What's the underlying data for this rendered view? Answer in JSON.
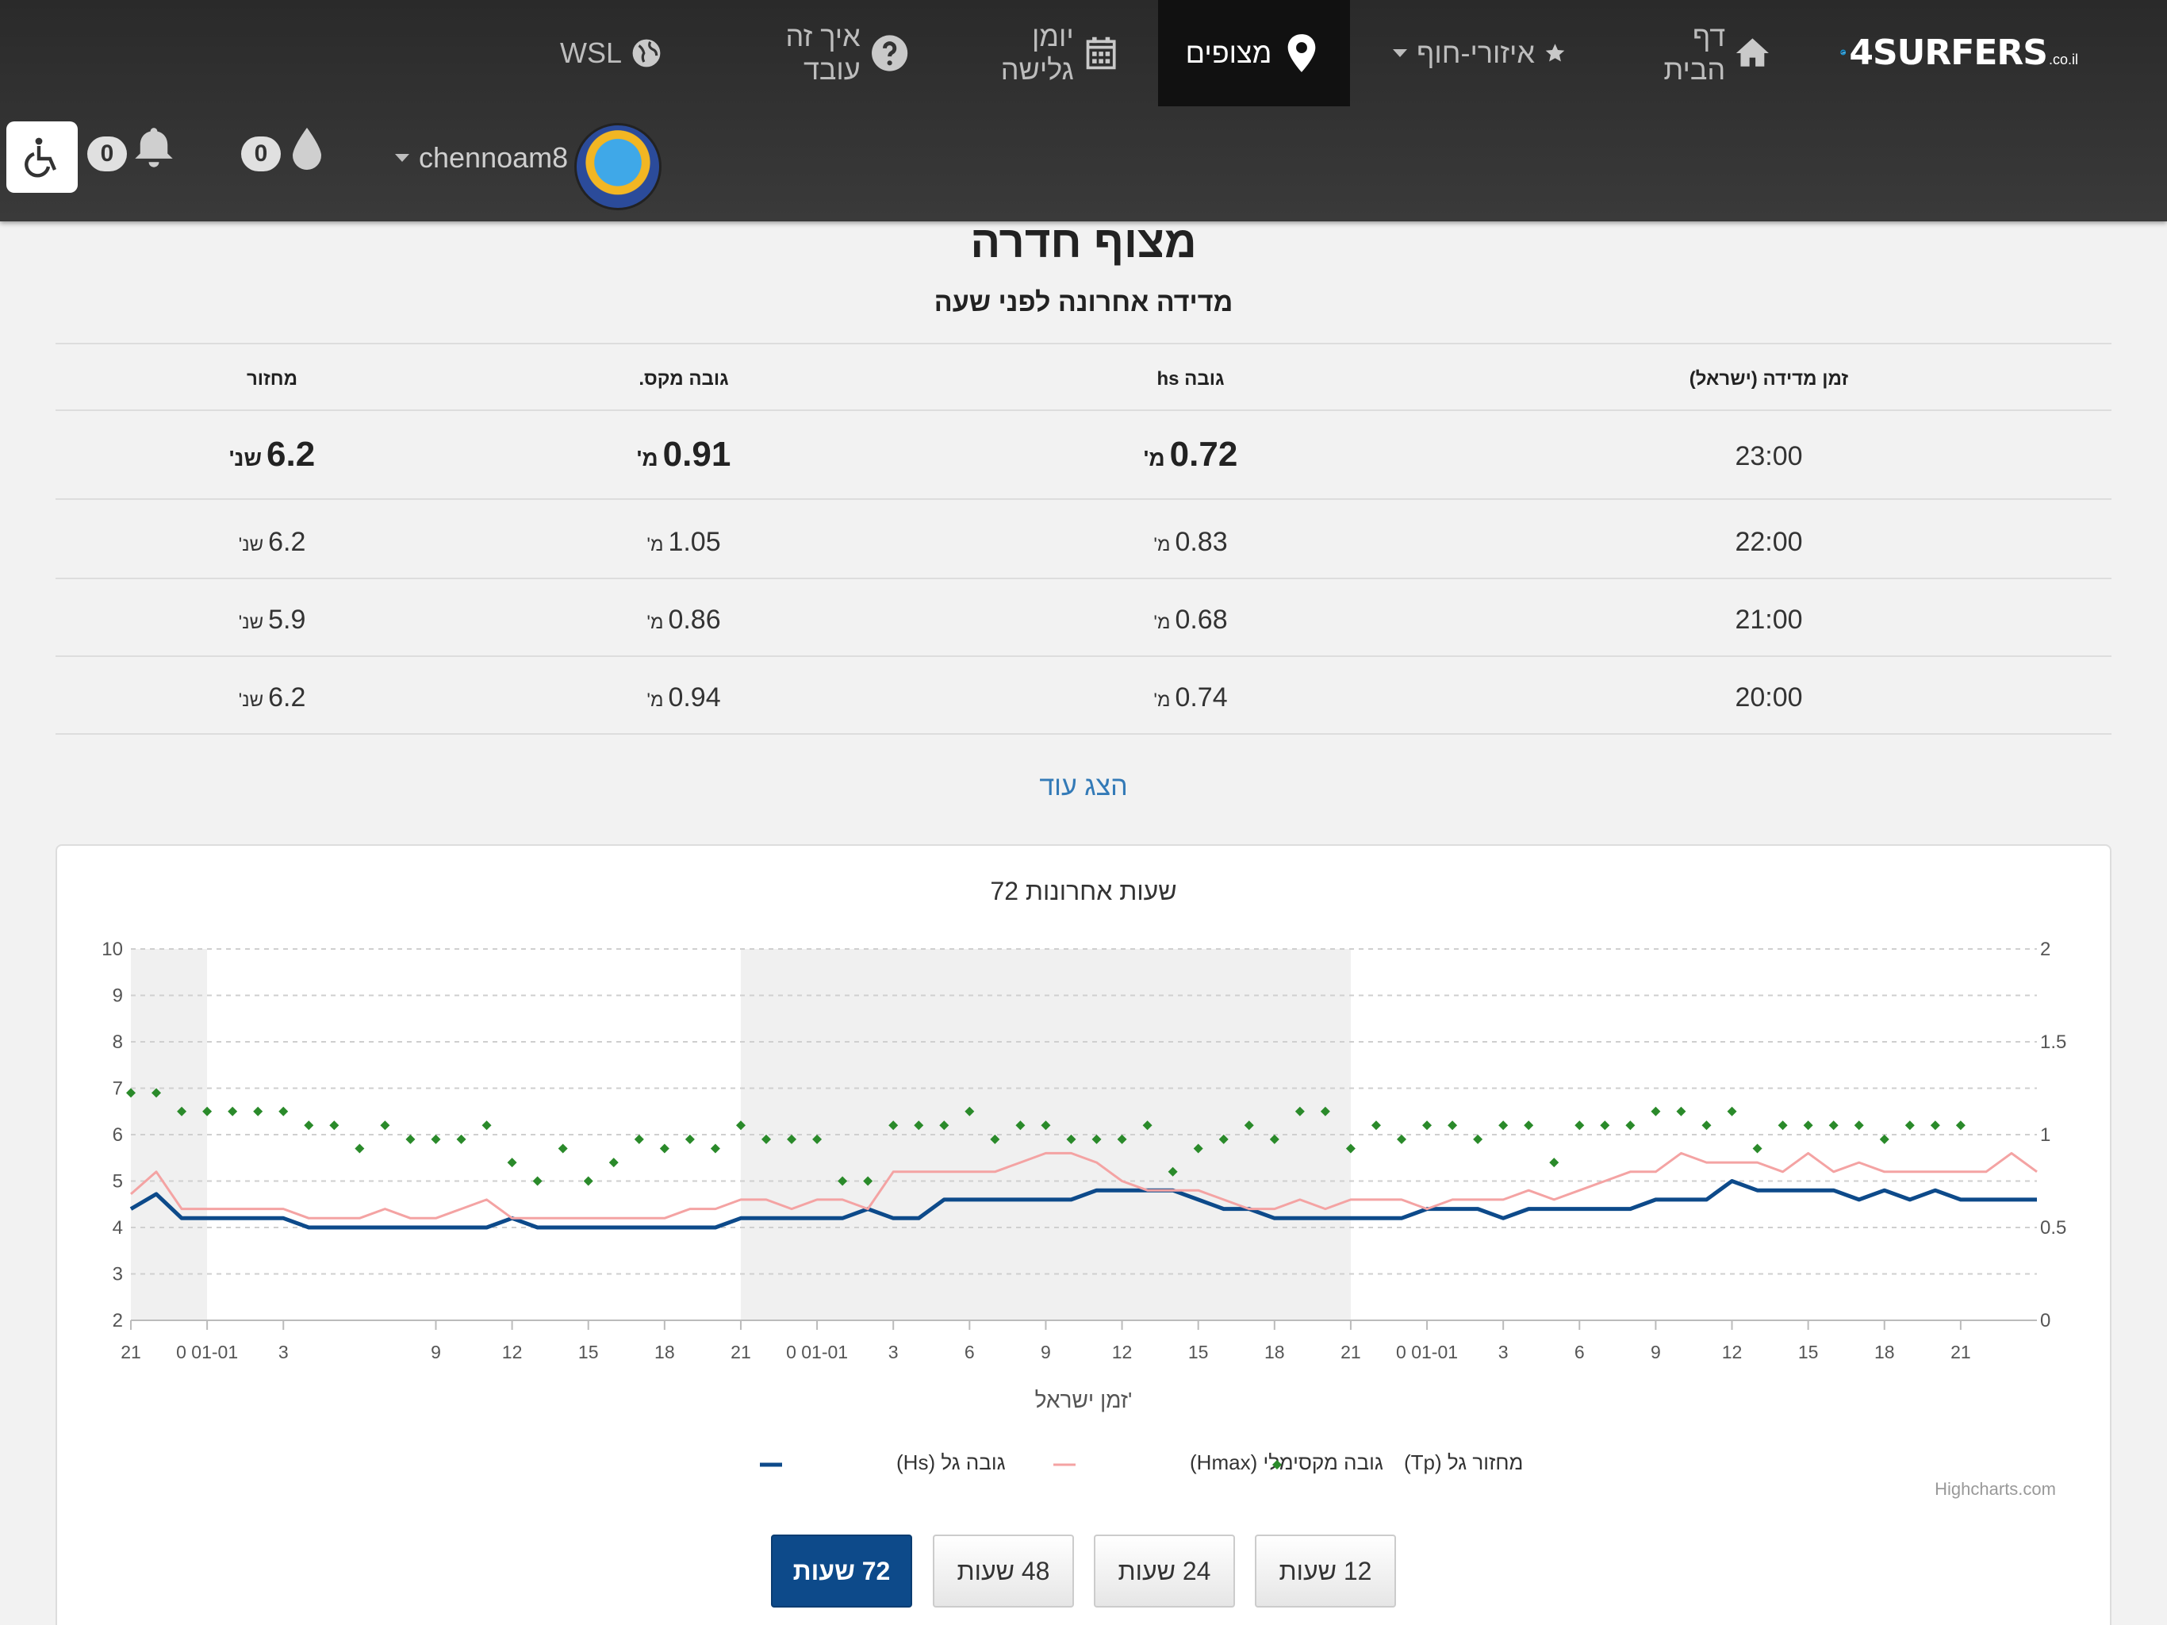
{
  "nav": {
    "logo_text": "4SURFERS",
    "logo_tld": ".co.il",
    "items": [
      {
        "label": "דף הבית",
        "icon": "home-icon"
      },
      {
        "label": "איזורי-חוף",
        "icon": "star-icon"
      },
      {
        "label": "מצופים",
        "icon": "map-marker-icon",
        "active": true
      },
      {
        "label": "יומן גלישה",
        "icon": "calendar-icon"
      },
      {
        "label": "איך זה עובד",
        "icon": "question-icon"
      },
      {
        "label": "WSL",
        "icon": "globe-icon"
      }
    ],
    "username": "chennoam8",
    "drops_count": "0",
    "notifications_count": "0"
  },
  "page": {
    "title": "מצוף חדרה",
    "subtitle": "מדידה אחרונה לפני שעה",
    "more_link": "הצג עוד"
  },
  "table": {
    "headers": [
      "זמן מדידה (ישראל)",
      "גובה hs",
      "גובה מקס.",
      "מחזור"
    ],
    "height_unit": "מ'",
    "period_unit": "שנ'",
    "rows": [
      {
        "time": "23:00",
        "hs": "0.72",
        "hmax": "0.91",
        "period": "6.2"
      },
      {
        "time": "22:00",
        "hs": "0.83",
        "hmax": "1.05",
        "period": "6.2"
      },
      {
        "time": "21:00",
        "hs": "0.68",
        "hmax": "0.86",
        "period": "5.9"
      },
      {
        "time": "20:00",
        "hs": "0.74",
        "hmax": "0.94",
        "period": "6.2"
      }
    ]
  },
  "chart_data": {
    "type": "line",
    "title": "72 שעות אחרונות",
    "xlabel": "זמן ישראל'",
    "credit": "Highcharts.com",
    "left_axis": {
      "min": 2,
      "max": 10,
      "ticks": [
        "2",
        "3",
        "4",
        "5",
        "6",
        "7",
        "8",
        "9",
        "10"
      ]
    },
    "right_axis": {
      "min": 0,
      "max": 2,
      "ticks": [
        "0",
        "0.5",
        "1",
        "1.5",
        "2"
      ]
    },
    "x_tick_labels": [
      "21",
      "0 01-01",
      "3",
      "9",
      "12",
      "15",
      "18",
      "21",
      "0 01-01",
      "3",
      "6",
      "9",
      "12",
      "15",
      "18",
      "21",
      "0 01-01",
      "3",
      "6",
      "9",
      "12",
      "15",
      "18",
      "21"
    ],
    "x_tick_hours": [
      0,
      3,
      6,
      12,
      15,
      18,
      21,
      24,
      27,
      30,
      33,
      36,
      39,
      42,
      45,
      48,
      51,
      54,
      57,
      60,
      63,
      66,
      69,
      72
    ],
    "night_bands": [
      [
        0,
        3
      ],
      [
        24,
        48
      ]
    ],
    "hours": [
      0,
      1,
      2,
      3,
      4,
      5,
      6,
      7,
      8,
      9,
      10,
      11,
      12,
      13,
      14,
      15,
      16,
      17,
      18,
      19,
      20,
      21,
      22,
      23,
      24,
      25,
      26,
      27,
      28,
      29,
      30,
      31,
      32,
      33,
      34,
      35,
      36,
      37,
      38,
      39,
      40,
      41,
      42,
      43,
      44,
      45,
      46,
      47,
      48,
      49,
      50,
      51,
      52,
      53,
      54,
      55,
      56,
      57,
      58,
      59,
      60,
      61,
      62,
      63,
      64,
      65,
      66,
      67,
      68,
      69,
      70,
      71,
      72,
      73,
      74,
      75
    ],
    "series": [
      {
        "name": "גובה גל (Hs)",
        "axis": "right",
        "color": "#0d4a8a",
        "values": [
          0.6,
          0.68,
          0.55,
          0.55,
          0.55,
          0.55,
          0.55,
          0.5,
          0.5,
          0.5,
          0.5,
          0.5,
          0.5,
          0.5,
          0.5,
          0.55,
          0.5,
          0.5,
          0.5,
          0.5,
          0.5,
          0.5,
          0.5,
          0.5,
          0.55,
          0.55,
          0.55,
          0.55,
          0.55,
          0.6,
          0.55,
          0.55,
          0.65,
          0.65,
          0.65,
          0.65,
          0.65,
          0.65,
          0.7,
          0.7,
          0.7,
          0.7,
          0.65,
          0.6,
          0.6,
          0.55,
          0.55,
          0.55,
          0.55,
          0.55,
          0.55,
          0.6,
          0.6,
          0.6,
          0.55,
          0.6,
          0.6,
          0.6,
          0.6,
          0.6,
          0.65,
          0.65,
          0.65,
          0.75,
          0.7,
          0.7,
          0.7,
          0.7,
          0.65,
          0.7,
          0.65,
          0.7,
          0.65,
          0.65,
          0.65,
          0.65,
          0.7,
          0.65
        ]
      },
      {
        "name": "גובה מקסימלי (Hmax)",
        "axis": "right",
        "color": "#f4a3a3",
        "values": [
          0.68,
          0.8,
          0.6,
          0.6,
          0.6,
          0.6,
          0.6,
          0.55,
          0.55,
          0.55,
          0.6,
          0.55,
          0.55,
          0.6,
          0.65,
          0.55,
          0.55,
          0.55,
          0.55,
          0.55,
          0.55,
          0.55,
          0.6,
          0.6,
          0.65,
          0.65,
          0.6,
          0.65,
          0.65,
          0.6,
          0.8,
          0.8,
          0.8,
          0.8,
          0.8,
          0.85,
          0.9,
          0.9,
          0.85,
          0.75,
          0.7,
          0.7,
          0.7,
          0.65,
          0.6,
          0.6,
          0.65,
          0.6,
          0.65,
          0.65,
          0.65,
          0.6,
          0.65,
          0.65,
          0.65,
          0.7,
          0.65,
          0.7,
          0.75,
          0.8,
          0.8,
          0.9,
          0.85,
          0.85,
          0.85,
          0.8,
          0.9,
          0.8,
          0.85,
          0.8,
          0.8,
          0.8,
          0.8,
          0.8,
          0.9,
          0.8
        ]
      },
      {
        "name": "מחזור גל (Tp)",
        "axis": "left",
        "color": "#2a8a2a",
        "type": "scatter",
        "values": [
          6.9,
          6.9,
          6.5,
          6.5,
          6.5,
          6.5,
          6.5,
          6.2,
          6.2,
          5.7,
          6.2,
          5.9,
          5.9,
          5.9,
          6.2,
          5.4,
          5,
          5.7,
          5,
          5.4,
          5.9,
          5.7,
          5.9,
          5.7,
          6.2,
          5.9,
          5.9,
          5.9,
          5,
          5,
          6.2,
          6.2,
          6.2,
          6.5,
          5.9,
          6.2,
          6.2,
          5.9,
          5.9,
          5.9,
          6.2,
          5.2,
          5.7,
          5.9,
          6.2,
          5.9,
          6.5,
          6.5,
          5.7,
          6.2,
          5.9,
          6.2,
          6.2,
          5.9,
          6.2,
          6.2,
          5.4,
          6.2,
          6.2,
          6.2,
          6.5,
          6.5,
          6.2,
          6.5,
          5.7,
          6.2,
          6.2,
          6.2,
          6.2,
          5.9,
          6.2,
          6.2,
          6.2
        ]
      }
    ],
    "legend_position": "bottom-center"
  },
  "range_buttons": [
    "12 שעות",
    "24 שעות",
    "48 שעות",
    "72 שעות"
  ],
  "range_active": "72 שעות"
}
